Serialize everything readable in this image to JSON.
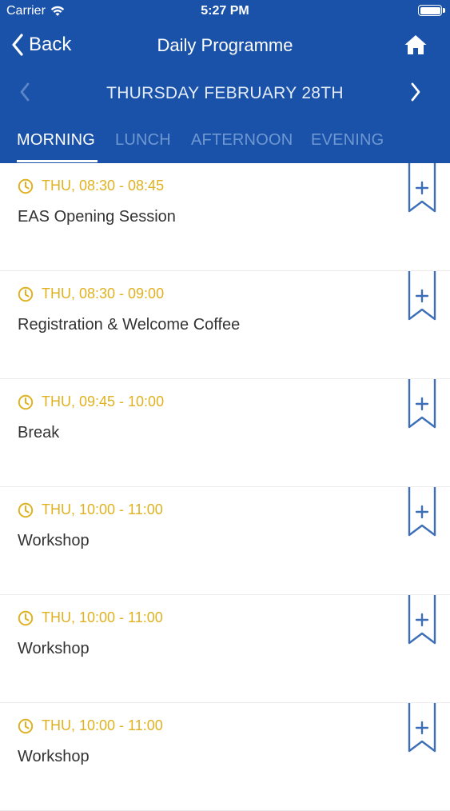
{
  "status_bar": {
    "carrier": "Carrier",
    "time": "5:27 PM"
  },
  "nav": {
    "back_label": "Back",
    "title": "Daily Programme",
    "home_icon": "home-icon"
  },
  "date_bar": {
    "label": "THURSDAY FEBRUARY 28TH"
  },
  "tabs": [
    {
      "label": "MORNING",
      "active": true
    },
    {
      "label": "LUNCH",
      "active": false
    },
    {
      "label": "AFTERNOON",
      "active": false
    },
    {
      "label": "EVENING",
      "active": false
    }
  ],
  "sessions": [
    {
      "time": "THU, 08:30 - 08:45",
      "title": "EAS Opening Session"
    },
    {
      "time": "THU, 08:30 - 09:00",
      "title": "Registration & Welcome Coffee"
    },
    {
      "time": "THU, 09:45 - 10:00",
      "title": "Break"
    },
    {
      "time": "THU, 10:00 - 11:00",
      "title": "Workshop"
    },
    {
      "time": "THU, 10:00 - 11:00",
      "title": "Workshop"
    },
    {
      "time": "THU, 10:00 - 11:00",
      "title": "Workshop"
    }
  ],
  "colors": {
    "header_bg": "#1a52a9",
    "time_accent": "#e0b120",
    "bookmark": "#3d6fb8"
  }
}
